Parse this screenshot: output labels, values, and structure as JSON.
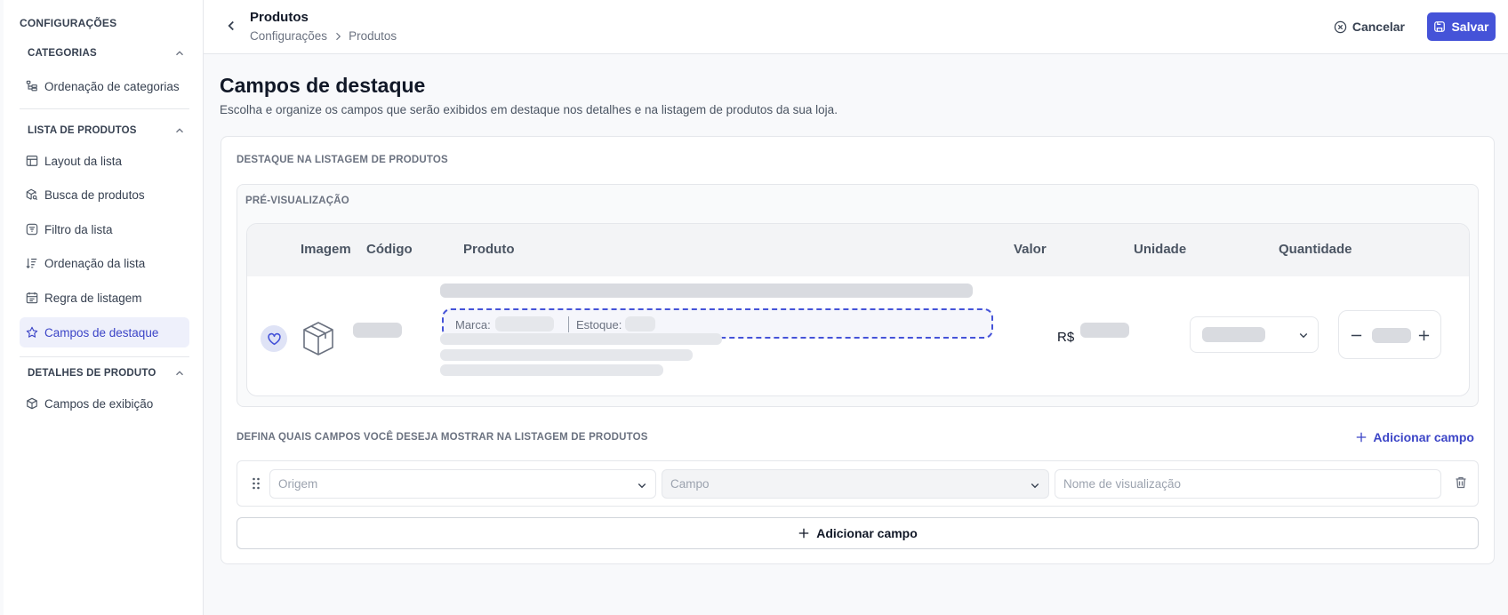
{
  "sidebar": {
    "title": "CONFIGURAÇÕES",
    "sections": [
      {
        "label": "CATEGORIAS",
        "items": [
          {
            "label": "Ordenação de categorias",
            "icon": "category-tree-icon"
          }
        ]
      },
      {
        "label": "LISTA DE PRODUTOS",
        "items": [
          {
            "label": "Layout da lista",
            "icon": "layout-icon"
          },
          {
            "label": "Busca de produtos",
            "icon": "search-package-icon"
          },
          {
            "label": "Filtro da lista",
            "icon": "filter-icon"
          },
          {
            "label": "Ordenação da lista",
            "icon": "sort-icon"
          },
          {
            "label": "Regra de listagem",
            "icon": "rule-icon"
          },
          {
            "label": "Campos de destaque",
            "icon": "star-icon",
            "active": true
          }
        ]
      },
      {
        "label": "DETALHES DE PRODUTO",
        "items": [
          {
            "label": "Campos de exibição",
            "icon": "package-icon"
          }
        ]
      }
    ]
  },
  "header": {
    "title": "Produtos",
    "breadcrumb": [
      "Configurações",
      "Produtos"
    ],
    "cancel_label": "Cancelar",
    "save_label": "Salvar"
  },
  "main": {
    "title": "Campos de destaque",
    "description": "Escolha e organize os campos que serão exibidos em destaque nos detalhes e na listagem de produtos da sua loja.",
    "listing_section_label": "DESTAQUE NA LISTAGEM DE PRODUTOS",
    "preview": {
      "label": "PRÉ-VISUALIZAÇÃO",
      "columns": [
        "Imagem",
        "Código",
        "Produto",
        "Valor",
        "Unidade",
        "Quantidade"
      ],
      "highlight_fields": [
        "Marca:",
        "Estoque:"
      ],
      "currency": "R$"
    },
    "fields_section_label": "DEFINA QUAIS CAMPOS VOCÊ DESEJA MOSTRAR NA LISTAGEM DE PRODUTOS",
    "add_field_link": "Adicionar campo",
    "field_row": {
      "origin_placeholder": "Origem",
      "field_placeholder": "Campo",
      "display_name_placeholder": "Nome de visualização"
    },
    "add_field_button": "Adicionar campo"
  },
  "colors": {
    "accent": "#4553d8",
    "active_bg": "#eef0fb",
    "placeholder": "#d9dbe0"
  }
}
